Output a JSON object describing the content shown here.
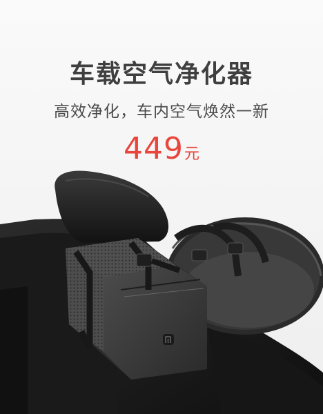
{
  "banner": {
    "title": "车载空气净化器",
    "subtitle": "高效净化，车内空气焕然一新",
    "price_value": "449",
    "price_unit": "元"
  },
  "product": {
    "logo_icon": "mi-logo-icon"
  },
  "colors": {
    "background": "#f4f4f4",
    "title": "#3f3f3f",
    "price": "#e8453c"
  }
}
